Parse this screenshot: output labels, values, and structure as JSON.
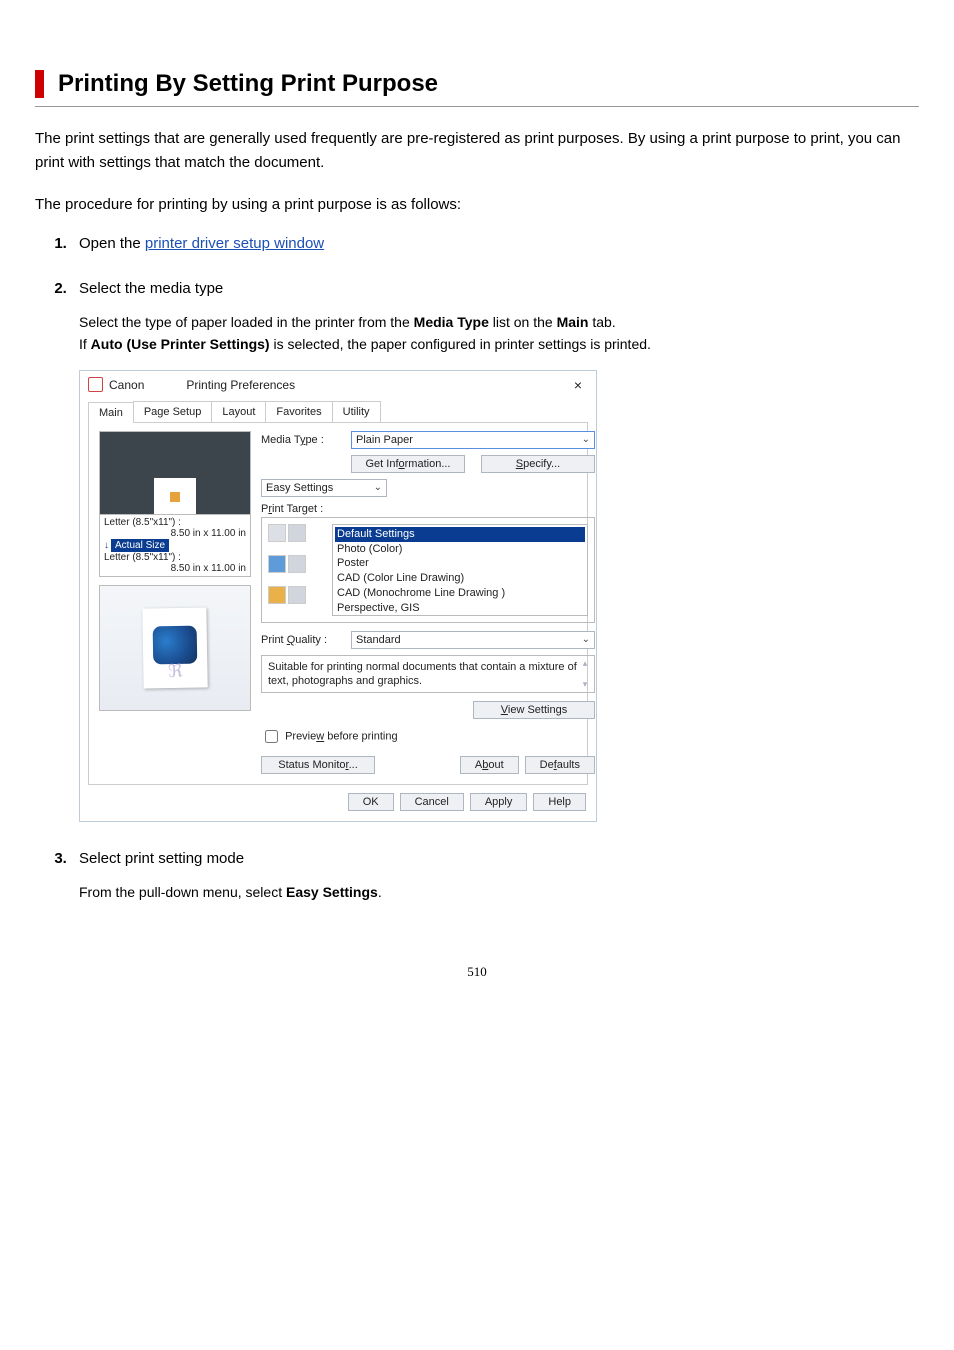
{
  "heading": "Printing By Setting Print Purpose",
  "intro1": "The print settings that are generally used frequently are pre-registered as print purposes. By using a print purpose to print, you can print with settings that match the document.",
  "intro2": "The procedure for printing by using a print purpose is as follows:",
  "steps": {
    "s1": {
      "prefix": "Open the ",
      "link": "printer driver setup window"
    },
    "s2": {
      "title": "Select the media type",
      "body1_a": "Select the type of paper loaded in the printer from the ",
      "body1_b": "Media Type",
      "body1_c": " list on the ",
      "body1_d": "Main",
      "body1_e": " tab.",
      "body2_a": "If ",
      "body2_b": "Auto (Use Printer Settings)",
      "body2_c": " is selected, the paper configured in printer settings is printed."
    },
    "s3": {
      "title": "Select print setting mode",
      "body_a": "From the pull-down menu, select ",
      "body_b": "Easy Settings",
      "body_c": "."
    }
  },
  "dialog": {
    "title_a": "Canon",
    "title_b": "Printing Preferences",
    "close": "×",
    "tabs": [
      "Main",
      "Page Setup",
      "Layout",
      "Favorites",
      "Utility"
    ],
    "media_type_label": "Media Type :",
    "media_type_value": "Plain Paper",
    "get_info": "Get Information...",
    "specify": "Specify...",
    "easy_settings": "Easy Settings",
    "print_target_label": "Print Target :",
    "targets": [
      "Default Settings",
      "Photo (Color)",
      "Poster",
      "CAD (Color Line Drawing)",
      "CAD (Monochrome Line Drawing )",
      "Perspective, GIS"
    ],
    "print_quality_label": "Print Quality :",
    "print_quality_value": "Standard",
    "description": "Suitable for printing normal documents that contain a mixture of text, photographs and graphics.",
    "view_settings": "View Settings",
    "preview_checkbox": "Preview before printing",
    "status_monitor": "Status Monitor...",
    "about": "About",
    "defaults": "Defaults",
    "ok": "OK",
    "cancel": "Cancel",
    "apply": "Apply",
    "help": "Help",
    "preview": {
      "letter1": "Letter (8.5\"x11\") :",
      "dim": "8.50 in x 11.00 in",
      "actual": "Actual Size",
      "letter2": "Letter (8.5\"x11\") :"
    }
  },
  "page_number": "510"
}
